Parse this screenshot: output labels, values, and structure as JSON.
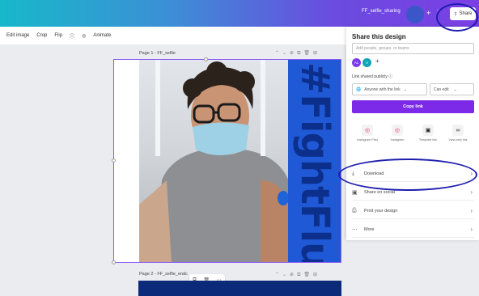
{
  "header": {
    "design_title": "FF_selfie_sharing",
    "share_label": "Share"
  },
  "toolbar": {
    "items": [
      "Edit image",
      "Crop",
      "Flip",
      "Animate"
    ]
  },
  "canvas": {
    "page1_label": "Page 1 - FF_selfie",
    "page2_label": "Page 2 - FF_selfie_endc",
    "hashtag_text": "#FightFlu"
  },
  "share_panel": {
    "title": "Share this design",
    "people_placeholder": "Add people, groups, or teams",
    "avatars": [
      "AL",
      "V"
    ],
    "link_label": "Link shared publicly",
    "access_select": "Anyone with the link",
    "permission_select": "Can edit",
    "copy_link_label": "Copy link",
    "share_options": [
      {
        "icon": "instagram-icon",
        "label": "Instagram Post"
      },
      {
        "icon": "instagram-icon",
        "label": "Instagram"
      },
      {
        "icon": "template-icon",
        "label": "Template link"
      },
      {
        "icon": "link-icon",
        "label": "View-only link"
      }
    ],
    "actions": [
      {
        "icon": "download-icon",
        "label": "Download"
      },
      {
        "icon": "share-social-icon",
        "label": "Share on social"
      },
      {
        "icon": "print-icon",
        "label": "Print your design"
      },
      {
        "icon": "more-icon",
        "label": "More"
      }
    ]
  },
  "colors": {
    "accent_purple": "#7d2ae8",
    "selection": "#8b5cf6",
    "hashtag_blue": "#1f59d6",
    "annotation": "#1d1db0"
  }
}
